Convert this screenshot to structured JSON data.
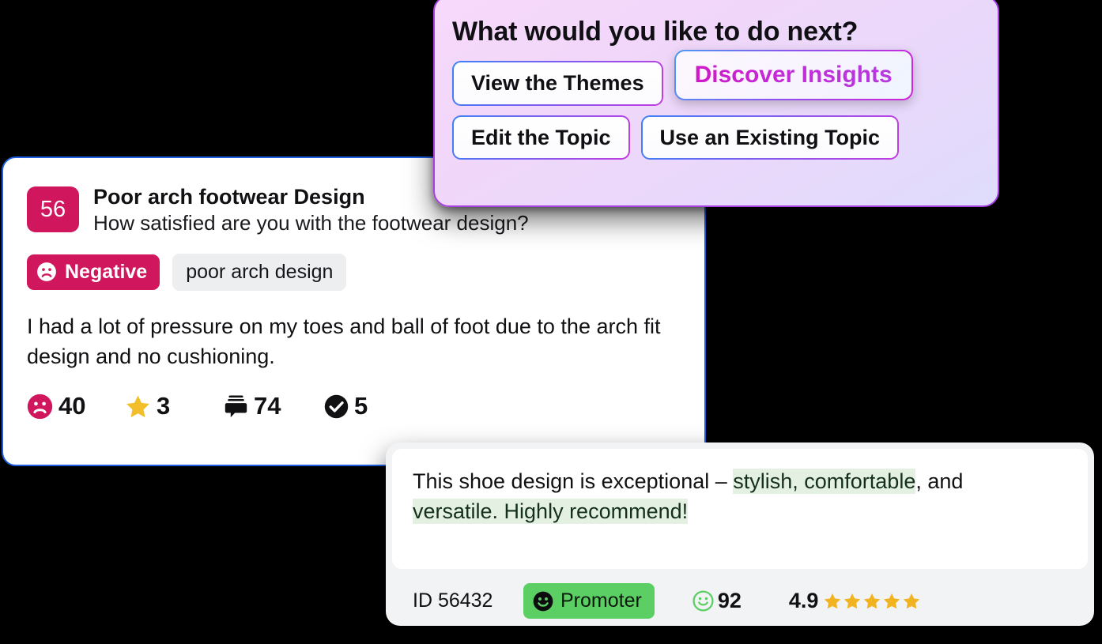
{
  "action_card": {
    "title": "What would you like to do next?",
    "buttons": [
      {
        "label": "View the Themes",
        "accent": false
      },
      {
        "label": "Discover Insights",
        "accent": true
      },
      {
        "label": "Edit the Topic",
        "accent": false
      },
      {
        "label": "Use an Existing Topic",
        "accent": false
      }
    ],
    "colors": {
      "border": "#a641e0",
      "background_start": "#f7d9fb",
      "background_end": "#dfdcfb",
      "accent_text": "#c21ad0"
    }
  },
  "feedback_card": {
    "score": "56",
    "title": "Poor arch footwear Design",
    "question": "How satisfied are you with the footwear design?",
    "sentiment_label": "Negative",
    "sentiment_icon": "frowning-face-icon",
    "tag_label": "poor arch design",
    "body": "I had a lot of pressure on my toes and ball of foot due to the arch fit design and no cushioning.",
    "stats": [
      {
        "icon": "frowning-face-icon",
        "value": "40"
      },
      {
        "icon": "star-icon",
        "value": "3"
      },
      {
        "icon": "comment-icon",
        "value": "74"
      },
      {
        "icon": "check-circle-icon",
        "value": "5"
      }
    ],
    "colors": {
      "border": "#1d5fe0",
      "badge": "#d0165c",
      "tag_background": "#eceef0"
    }
  },
  "review_card": {
    "quote_segments": [
      {
        "text": "This shoe design is exceptional – ",
        "highlight": false
      },
      {
        "text": "stylish, comfortable",
        "highlight": true
      },
      {
        "text": ", and",
        "highlight": false
      },
      {
        "text": "versatile. Highly recommend!",
        "highlight": true
      }
    ],
    "quote_line_1_plain": "This shoe design is exceptional – ",
    "quote_line_1_highlight": "stylish, comfortable",
    "quote_line_1_tail": ", and",
    "quote_line_2_highlight": "versatile. Highly recommend!",
    "id_label": "ID 56432",
    "promoter_label": "Promoter",
    "promoter_icon": "smiley-face-icon",
    "nps_icon": "smiley-outline-icon",
    "nps_score": "92",
    "rating_value": "4.9",
    "rating_stars": 5,
    "colors": {
      "card_background": "#f2f3f5",
      "highlight": "#e4f1e2",
      "promoter": "#5bcf63",
      "star": "#f2b321"
    }
  }
}
